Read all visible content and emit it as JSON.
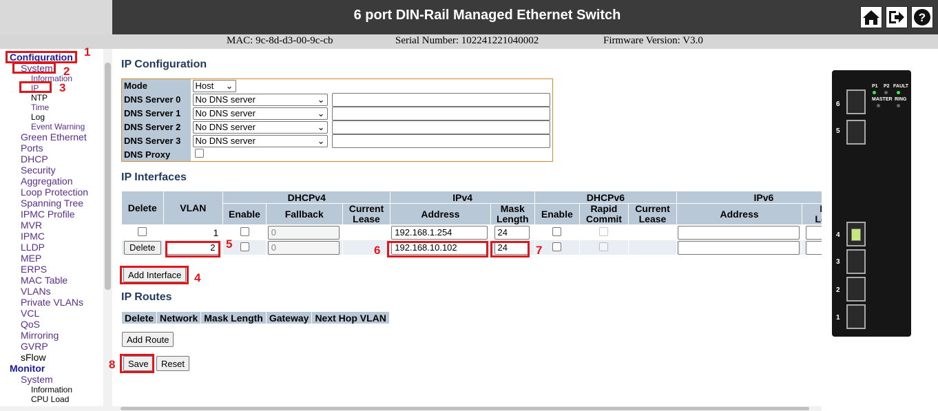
{
  "header": {
    "title": "6 port DIN-Rail Managed Ethernet Switch"
  },
  "info": {
    "mac": "MAC: 9c-8d-d3-00-9c-cb",
    "serial": "Serial Number: 102241221040002",
    "firmware": "Firmware Version: V3.0"
  },
  "nav": {
    "configuration": "Configuration",
    "system": "System",
    "information": "Information",
    "ip": "IP",
    "ntp": "NTP",
    "time": "Time",
    "log": "Log",
    "event_warning": "Event Warning",
    "items": [
      "Green Ethernet",
      "Ports",
      "DHCP",
      "Security",
      "Aggregation",
      "Loop Protection",
      "Spanning Tree",
      "IPMC Profile",
      "MVR",
      "IPMC",
      "LLDP",
      "MEP",
      "ERPS",
      "MAC Table",
      "VLANs",
      "Private VLANs",
      "VCL",
      "QoS",
      "Mirroring",
      "GVRP"
    ],
    "sflow": "sFlow",
    "monitor": "Monitor",
    "monitor_system": "System",
    "monitor_information": "Information",
    "cpu_load": "CPU Load"
  },
  "ip_config": {
    "title": "IP Configuration",
    "mode_label": "Mode",
    "mode_value": "Host",
    "dns0_label": "DNS Server 0",
    "dns1_label": "DNS Server 1",
    "dns2_label": "DNS Server 2",
    "dns3_label": "DNS Server 3",
    "dns_value": "No DNS server",
    "proxy_label": "DNS Proxy"
  },
  "ip_interfaces": {
    "title": "IP Interfaces",
    "h_delete": "Delete",
    "h_vlan": "VLAN",
    "h_dhcpv4": "DHCPv4",
    "h_ipv4": "IPv4",
    "h_dhcpv6": "DHCPv6",
    "h_ipv6": "IPv6",
    "h_enable": "Enable",
    "h_fallback": "Fallback",
    "h_current": "Current",
    "h_lease": "Lease",
    "h_address": "Address",
    "h_mask": "Mask",
    "h_length": "Length",
    "h_rapid": "Rapid",
    "h_commit": "Commit",
    "h_ma": "Ma",
    "h_len": "Leng",
    "row1": {
      "vlan": "1",
      "fallback": "0",
      "address": "192.168.1.254",
      "mask": "24"
    },
    "row2": {
      "delete": "Delete",
      "vlan": "2",
      "fallback": "0",
      "address": "192.168.10.102",
      "mask": "24"
    },
    "add_button": "Add Interface"
  },
  "ip_routes": {
    "title": "IP Routes",
    "cols": [
      "Delete",
      "Network",
      "Mask Length",
      "Gateway",
      "Next Hop VLAN"
    ],
    "add_button": "Add Route"
  },
  "actions": {
    "save": "Save",
    "reset": "Reset"
  },
  "annotations": [
    "1",
    "2",
    "3",
    "4",
    "5",
    "6",
    "7",
    "8"
  ],
  "device": {
    "leds": [
      "P1",
      "P2",
      "FAULT",
      "MASTER",
      "RING"
    ],
    "ports": [
      "6",
      "5",
      "4",
      "3",
      "2",
      "1"
    ]
  }
}
